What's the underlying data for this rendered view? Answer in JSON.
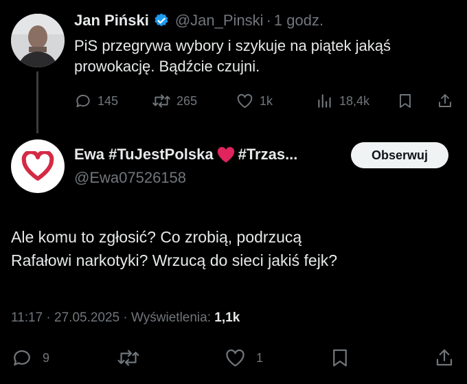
{
  "quoted_tweet": {
    "author_name": "Jan Piński",
    "handle": "@Jan_Pinski",
    "separator": "·",
    "time": "1 godz.",
    "text_line1": "PiS przegrywa wybory i szykuje na piątek jakąś",
    "text_line2": "prowokację. Bądźcie czujni.",
    "replies": "145",
    "reposts": "265",
    "likes": "1k",
    "views": "18,4k"
  },
  "main_tweet": {
    "author_name": "Ewa #TuJestPolska",
    "author_suffix": "#Trzas...",
    "handle": "@Ewa07526158",
    "follow_label": "Obserwuj",
    "text_line1": "Ale komu to zgłosić? Co zrobią, podrzucą",
    "text_line2": "Rafałowi narkotyki? Wrzucą do sieci jakiś fejk?",
    "time": "11:17",
    "date": "27.05.2025",
    "views_label": "Wyświetlenia:",
    "views_value": "1,1k",
    "replies": "9",
    "likes": "1"
  },
  "colors": {
    "background": "#000000",
    "text": "#e7e9ea",
    "muted": "#71767b",
    "verified": "#1d9bf0",
    "heart_red": "#e0245e"
  },
  "icons": [
    "reply-icon",
    "repost-icon",
    "like-icon",
    "views-icon",
    "bookmark-icon",
    "share-icon",
    "verified-badge-icon",
    "heart-emoji-icon"
  ]
}
